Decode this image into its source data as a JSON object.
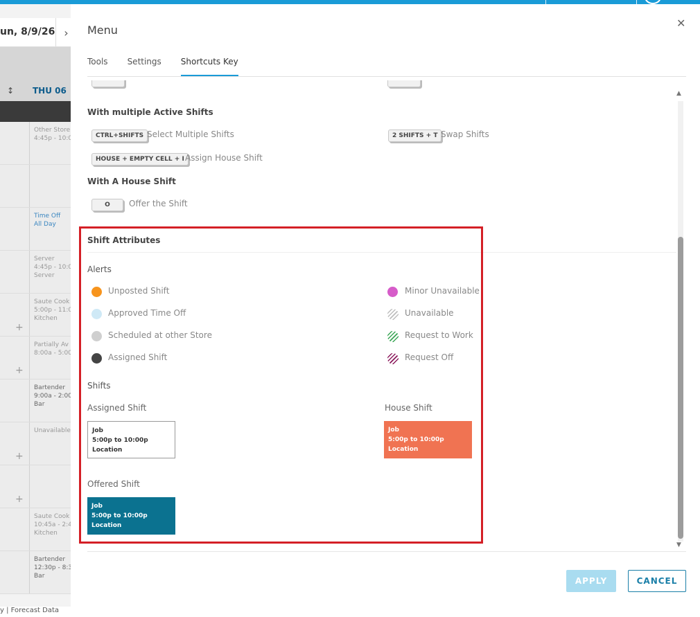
{
  "background": {
    "date": "un, 8/9/26",
    "next_icon": "chevron-right-icon",
    "sort_icon": "sort-icon",
    "day_header": "THU 06",
    "cells": [
      {
        "text": "Other Store\n4:45p - 10:0",
        "style": "muted",
        "plus": false
      },
      {
        "text": "",
        "style": "muted",
        "plus": false
      },
      {
        "text": "Time Off\nAll Day",
        "style": "blue",
        "plus": false
      },
      {
        "text": "Server\n4:45p - 10:0\nServer",
        "style": "muted",
        "plus": false
      },
      {
        "text": "Saute Cook\n5:00p - 11:0\nKitchen",
        "style": "muted",
        "plus": true
      },
      {
        "text": "Partially Av\n8:00a - 5:00",
        "style": "muted",
        "plus": true
      },
      {
        "text": "Bartender\n9:00a - 2:00\nBar",
        "style": "dark",
        "plus": false
      },
      {
        "text": "Unavailable",
        "style": "muted",
        "plus": true
      },
      {
        "text": "",
        "style": "muted",
        "plus": true
      },
      {
        "text": "Saute Cook\n10:45a - 2:4\nKitchen",
        "style": "muted",
        "plus": false
      },
      {
        "text": "Bartender\n12:30p - 8:3\nBar",
        "style": "dark",
        "plus": false
      }
    ],
    "footer_text": "y | Forecast Data"
  },
  "modal": {
    "title": "Menu",
    "close_icon": "close-icon",
    "tabs": [
      {
        "label": "Tools"
      },
      {
        "label": "Settings"
      },
      {
        "label": "Shortcuts Key",
        "active": true
      }
    ],
    "shortcuts": {
      "multiple_heading": "With multiple Active Shifts",
      "select_multiple": {
        "key": "CTRL+SHIFTS",
        "label": "Select Multiple Shifts"
      },
      "swap": {
        "key": "2 SHIFTS + T",
        "label": "Swap Shifts"
      },
      "assign_house": {
        "key": "HOUSE + EMPTY CELL + I",
        "label": "Assign House Shift"
      },
      "house_heading": "With A House Shift",
      "offer": {
        "key": "O",
        "label": "Offer the Shift"
      }
    },
    "attributes": {
      "heading": "Shift Attributes",
      "alerts_heading": "Alerts",
      "alerts_left": [
        {
          "label": "Unposted Shift",
          "color": "#f7941d"
        },
        {
          "label": "Approved Time Off",
          "color": "#cfe9f6"
        },
        {
          "label": "Scheduled at other Store",
          "color": "#cfcfcf"
        },
        {
          "label": "Assigned Shift",
          "color": "#444444"
        }
      ],
      "alerts_right": [
        {
          "label": "Minor Unavailable",
          "kind": "solid",
          "color": "#d65cc9"
        },
        {
          "label": "Unavailable",
          "kind": "hatch",
          "color": "#bdbdbd"
        },
        {
          "label": "Request to Work",
          "kind": "hatch",
          "color": "#3aa655"
        },
        {
          "label": "Request Off",
          "kind": "hatch",
          "color": "#8b1a5c"
        }
      ],
      "shifts_heading": "Shifts",
      "assigned": {
        "title": "Assigned Shift",
        "job": "Job",
        "time": "5:00p to 10:00p",
        "location": "Location"
      },
      "house": {
        "title": "House Shift",
        "job": "Job",
        "time": "5:00p to 10:00p",
        "location": "Location",
        "color": "#f07352"
      },
      "offered": {
        "title": "Offered Shift",
        "job": "Job",
        "time": "5:00p to 10:00p",
        "location": "Location",
        "color": "#0b7290"
      }
    },
    "buttons": {
      "apply": "APPLY",
      "cancel": "CANCEL"
    }
  }
}
